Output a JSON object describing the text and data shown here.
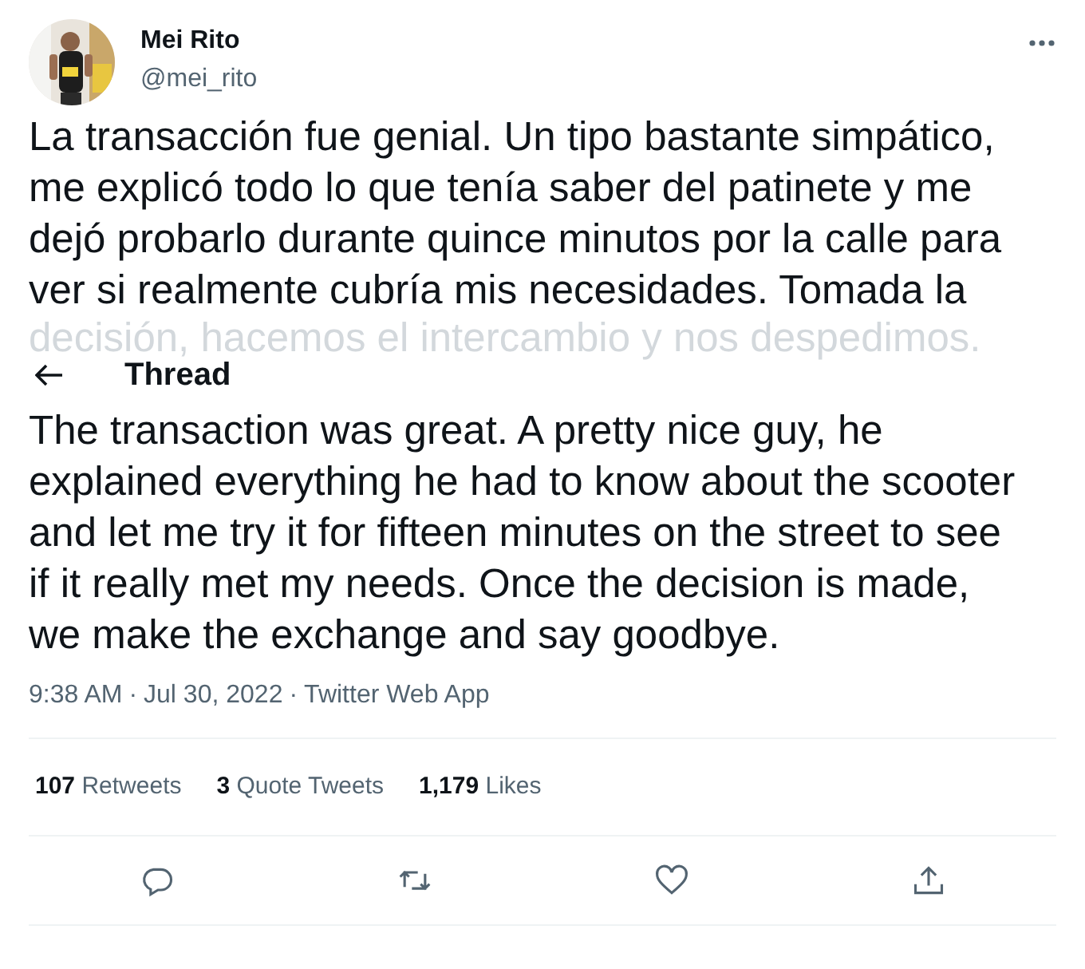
{
  "author": {
    "name": "Mei Rito",
    "handle": "@mei_rito"
  },
  "original_text": {
    "lines": [
      "La transacción fue genial. Un tipo bastante simpático,",
      "me explicó todo lo que tenía saber del patinete y me",
      "dejó probarlo durante quince minutos por la calle para",
      "ver si realmente cubría mis necesidades. Tomada la"
    ],
    "faded_line": "decisión, hacemos el intercambio y nos despedimos."
  },
  "header": {
    "title": "Thread"
  },
  "translated_text": {
    "lines": [
      "The transaction was great. A pretty nice guy, he",
      "explained everything he had to know about the scooter",
      "and let me try it for fifteen minutes on the street to see",
      "if it really met my needs. Once the decision is made,",
      "we make the exchange and say goodbye."
    ]
  },
  "meta": {
    "time": "9:38 AM",
    "separator_1": "·",
    "date": "Jul 30, 2022",
    "separator_2": "·",
    "source": "Twitter Web App"
  },
  "stats": [
    {
      "count": "107",
      "label": "Retweets"
    },
    {
      "count": "3",
      "label": "Quote Tweets"
    },
    {
      "count": "1,179",
      "label": "Likes"
    }
  ]
}
